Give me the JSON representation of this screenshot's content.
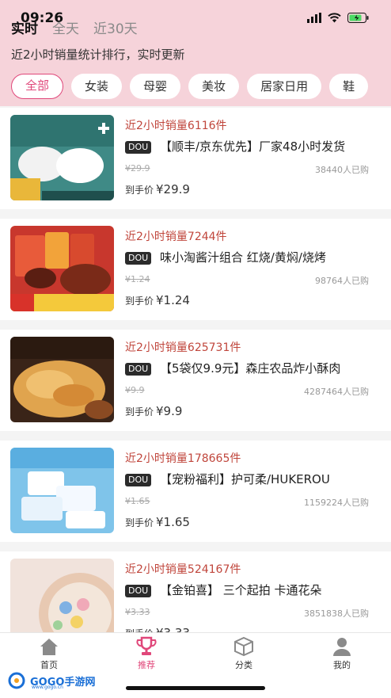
{
  "status": {
    "time": "09:26"
  },
  "header": {
    "tabs": [
      {
        "label": "实时",
        "active": true
      },
      {
        "label": "全天",
        "active": false
      },
      {
        "label": "近30天",
        "active": false
      }
    ],
    "subtitle": "近2小时销量统计排行，实时更新"
  },
  "categories": [
    {
      "label": "全部",
      "active": true
    },
    {
      "label": "女装",
      "active": false
    },
    {
      "label": "母婴",
      "active": false
    },
    {
      "label": "美妆",
      "active": false
    },
    {
      "label": "居家日用",
      "active": false
    },
    {
      "label": "鞋",
      "active": false
    }
  ],
  "products": [
    {
      "sales": "近2小时销量6116件",
      "badge": "DOU",
      "title": "【顺丰/京东优先】厂家48小时发货",
      "original_price": "¥29.9",
      "buyers": "38440人已购",
      "final_label": "到手价",
      "final_price": "¥29.9"
    },
    {
      "sales": "近2小时销量7244件",
      "badge": "DOU",
      "title": "味小淘酱汁组合 红烧/黄焖/烧烤",
      "original_price": "¥1.24",
      "buyers": "98764人已购",
      "final_label": "到手价",
      "final_price": "¥1.24"
    },
    {
      "sales": "近2小时销量625731件",
      "badge": "DOU",
      "title": "【5袋仅9.9元】森庄农品炸小酥肉",
      "original_price": "¥9.9",
      "buyers": "4287464人已购",
      "final_label": "到手价",
      "final_price": "¥9.9"
    },
    {
      "sales": "近2小时销量178665件",
      "badge": "DOU",
      "title": "【宠粉福利】护可柔/HUKEROU",
      "original_price": "¥1.65",
      "buyers": "1159224人已购",
      "final_label": "到手价",
      "final_price": "¥1.65"
    },
    {
      "sales": "近2小时销量524167件",
      "badge": "DOU",
      "title": "【金铂喜】 三个起拍 卡通花朵",
      "original_price": "¥3.33",
      "buyers": "3851838人已购",
      "final_label": "到手价",
      "final_price": "¥3.33"
    }
  ],
  "bottom_nav": [
    {
      "label": "首页",
      "icon": "home-icon",
      "active": false
    },
    {
      "label": "推荐",
      "icon": "trophy-icon",
      "active": true
    },
    {
      "label": "分类",
      "icon": "box-icon",
      "active": false
    },
    {
      "label": "我的",
      "icon": "user-icon",
      "active": false
    }
  ],
  "watermark": {
    "text": "GOGO手游网",
    "sub": "www.gogo.cn"
  },
  "colors": {
    "accent": "#e0477a",
    "sales_red": "#c0463c",
    "header_bg": "#f6d3da"
  }
}
